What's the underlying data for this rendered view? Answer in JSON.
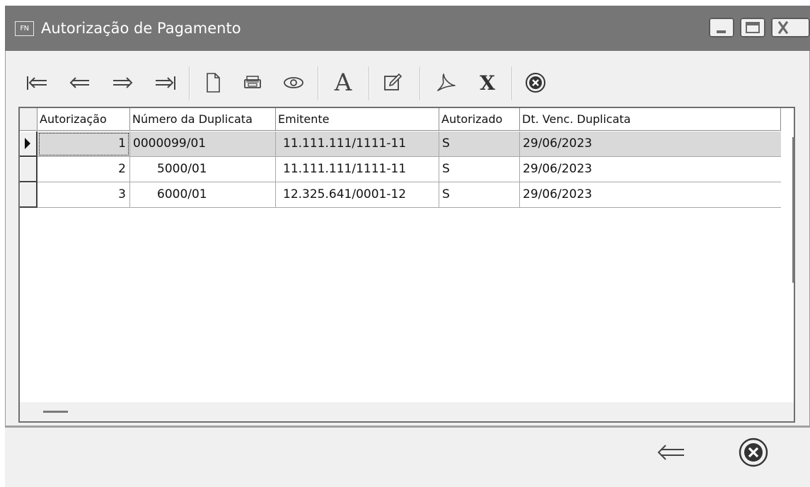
{
  "window": {
    "app_badge": "FN",
    "title": "Autorização de Pagamento"
  },
  "toolbar": {
    "buttons": [
      {
        "icon": "first-record-icon"
      },
      {
        "icon": "prior-record-icon"
      },
      {
        "icon": "next-record-icon"
      },
      {
        "icon": "last-record-icon"
      },
      {
        "icon": "new-document-icon"
      },
      {
        "icon": "print-icon"
      },
      {
        "icon": "view-eye-icon"
      },
      {
        "icon": "font-a-icon",
        "glyph": "A"
      },
      {
        "icon": "edit-icon"
      },
      {
        "icon": "pdf-icon"
      },
      {
        "icon": "excel-x-icon",
        "glyph": "X"
      },
      {
        "icon": "cancel-circle-icon"
      }
    ]
  },
  "grid": {
    "columns": [
      "Autorização",
      "Número da Duplicata",
      "Emitente",
      "Autorizado",
      "Dt. Venc. Duplicata"
    ],
    "rows": [
      {
        "autorizacao": "1",
        "numero": "0000099/01",
        "emitente": "11.111.111/1111-11",
        "autorizado": "S",
        "vencimento": "29/06/2023"
      },
      {
        "autorizacao": "2",
        "numero": "5000/01",
        "emitente": "11.111.111/1111-11",
        "autorizado": "S",
        "vencimento": "29/06/2023"
      },
      {
        "autorizacao": "3",
        "numero": "6000/01",
        "emitente": "12.325.641/0001-12",
        "autorizado": "S",
        "vencimento": "29/06/2023"
      }
    ],
    "selected_row": 1
  },
  "footer": {
    "back_icon": "back-arrow-icon",
    "close_icon": "close-circle-icon"
  },
  "colors": {
    "titlebar": "#767676",
    "window_bg": "#f0f0f0",
    "selected_row": "#d9d9d9"
  }
}
